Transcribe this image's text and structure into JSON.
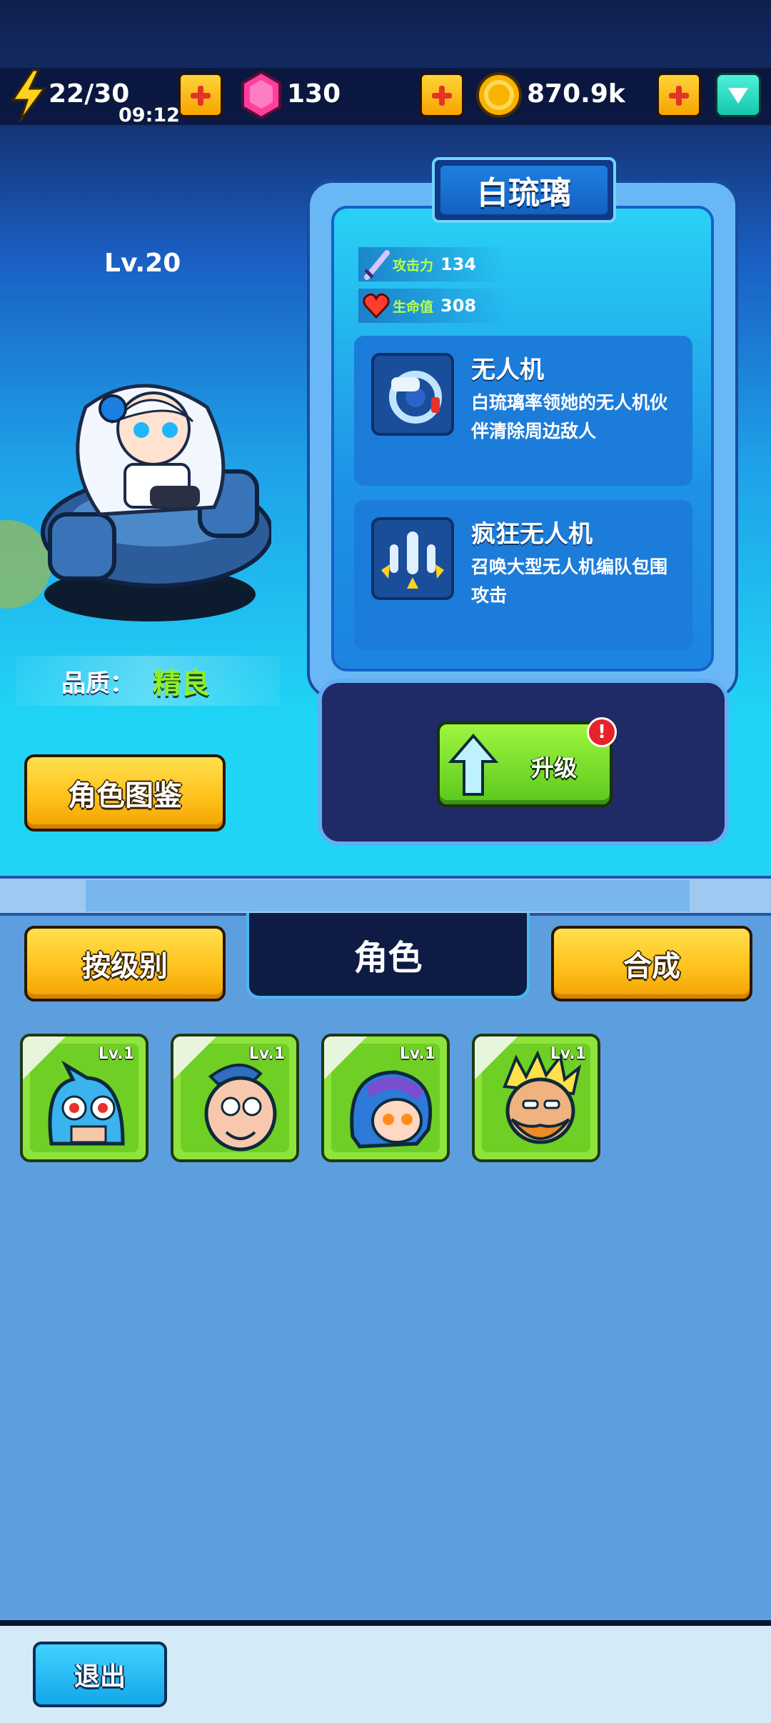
{
  "resources": {
    "energy": "22/30",
    "energy_timer": "09:12",
    "gems": "130",
    "coins": "870.9k"
  },
  "character": {
    "level": "Lv.20",
    "quality_label": "品质：",
    "quality_value": "精良",
    "name": "白琉璃",
    "attack_label": "攻击力",
    "attack_value": "134",
    "hp_label": "生命值",
    "hp_value": "308",
    "skills": [
      {
        "name": "无人机",
        "desc": "白琉璃率领她的无人机伙伴清除周边敌人"
      },
      {
        "name": "疯狂无人机",
        "desc": "召唤大型无人机编队包围攻击"
      }
    ]
  },
  "buttons": {
    "codex": "角色图鉴",
    "upgrade": "升级",
    "upgrade_alert": "!",
    "by_level": "按级别",
    "merge": "合成",
    "exit": "退出"
  },
  "tab_title": "角色",
  "roster": [
    {
      "level": "Lv.1",
      "portrait": "blue-monster-icon"
    },
    {
      "level": "Lv.1",
      "portrait": "bald-glasses-man-icon"
    },
    {
      "level": "Lv.1",
      "portrait": "purple-hood-girl-icon"
    },
    {
      "level": "Lv.1",
      "portrait": "bearded-old-man-icon"
    }
  ],
  "colors": {
    "accent_yellow": "#ffc21d",
    "accent_green": "#6fcf24",
    "quality_green": "#8ef02e",
    "panel_blue": "#1c84df"
  }
}
